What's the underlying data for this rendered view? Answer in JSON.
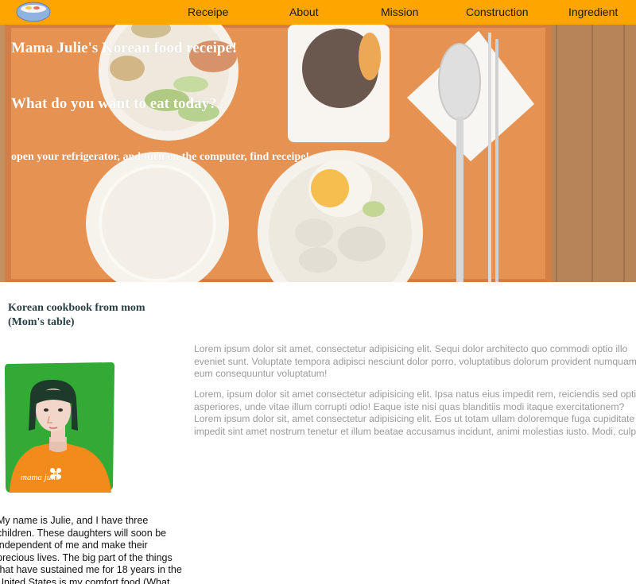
{
  "nav": {
    "logo_icon": "bowl-logo-icon",
    "links": [
      "Receipe",
      "About",
      "Mission",
      "Construction",
      "Ingredient"
    ],
    "background": "#ffa500"
  },
  "hero": {
    "title": "Mama Julie's Korean food receipe!",
    "question": "What do you want to eat today?",
    "subtitle": "open your refrigerator, and turn on the computer, find receipe!"
  },
  "intro": {
    "title_line1": "Korean cookbook from mom",
    "title_line2": "(Mom's table)",
    "portrait_caption": "mama julie",
    "bio": "My name is Julie, and I have three children. These daughters will soon be independent of me and make their precious lives. The big part of the things that have sustained me for 18 years in the United States is my comfort food (What"
  },
  "content": {
    "paragraph1": "Lorem ipsum dolor sit amet, consectetur adipisicing elit. Sequi dolor architecto quo commodi optio illo eveniet sunt. Voluptate tempora adipisci nesciunt dolor porro, voluptatibus dolorum provident numquam, eum consequuntur voluptatum!",
    "paragraph2": "Lorem, ipsum dolor sit amet consectetur adipisicing elit. Ipsa natus eius impedit rem, reiciendis sed optio asperiores, unde vitae illum corrupti odio! Eaque iste nisi quas blanditiis modi itaque exercitationem?Lorem ipsum dolor sit, amet consectetur adipisicing elit. Eos ut totam ullam doloremque fuga cupiditate impedit sint amet nostrum tenetur et illum beatae accusamus incidunt, animi molestias iusto. Modi, culpa?"
  }
}
